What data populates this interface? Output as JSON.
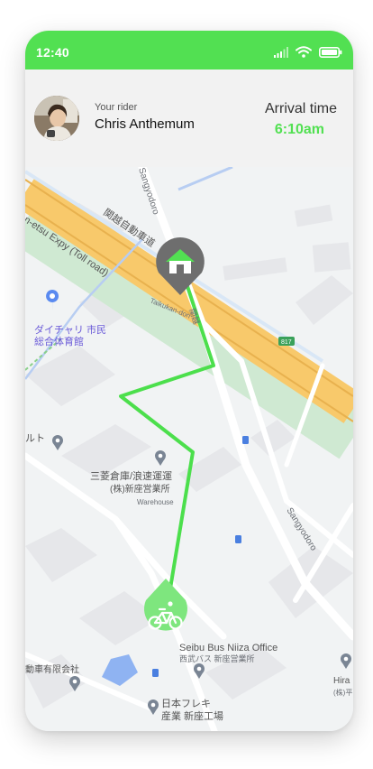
{
  "status_bar": {
    "time": "12:40",
    "icons": [
      "signal-icon",
      "wifi-icon",
      "battery-icon"
    ]
  },
  "rider": {
    "caption": "Your rider",
    "name": "Chris Anthemum"
  },
  "arrival": {
    "label": "Arrival time",
    "time": "6:10am"
  },
  "map": {
    "labels": {
      "expressway": "n-etsu Expy (Toll road)",
      "expressway_jp": "関越自動車道",
      "sangyodoro_top": "Sangyodoro",
      "sangyodoro_right": "Sangyodoro",
      "taikukan": "Taikukan-dori",
      "daichari_1": "ダイチャリ 市民",
      "daichari_2": "総合体育館",
      "ruto": "ルト",
      "mitsubishi_1": "三菱倉庫/浪速運運",
      "mitsubishi_2": "(株)新座営業所",
      "warehouse": "Warehouse",
      "seibu_1": "Seibu Bus Niiza Office",
      "seibu_2": "西武バス 新座営業所",
      "jidousha": "動車有限会社",
      "nihon_1": "日本フレキ",
      "nihon_2": "産業 新座工場",
      "hira_1": "Hira",
      "hira_2": "(株)平",
      "road_num": "817",
      "road_small": "関越"
    },
    "route_color": "#4cdf4c",
    "home_pin_color": "#6e6e6e",
    "bike_pin_color": "#7ee67e",
    "icons": [
      "home-icon",
      "bicycle-icon"
    ]
  }
}
